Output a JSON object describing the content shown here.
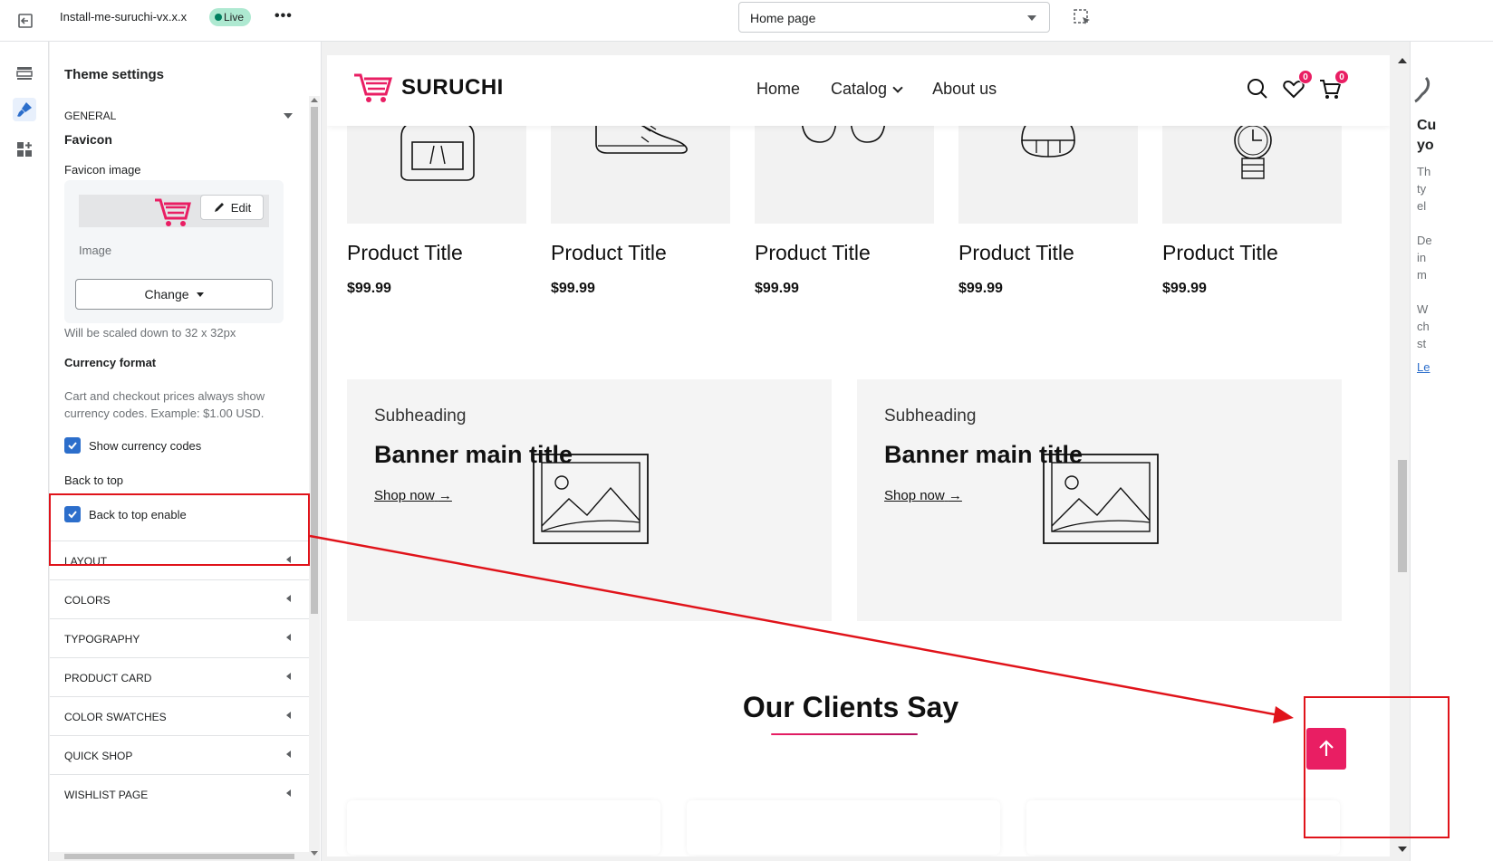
{
  "topbar": {
    "theme_name": "Install-me-suruchi-vx.x.x",
    "status": "Live",
    "more": "•••",
    "page_select": "Home page"
  },
  "sidebar": {
    "title": "Theme settings",
    "general": {
      "label": "GENERAL",
      "favicon_heading": "Favicon",
      "favicon_image_label": "Favicon image",
      "edit_label": "Edit",
      "image_label": "Image",
      "change_label": "Change",
      "scale_note": "Will be scaled down to 32 x 32px",
      "currency_heading": "Currency format",
      "currency_note": "Cart and checkout prices always show currency codes. Example: $1.00 USD.",
      "show_currency_codes": "Show currency codes",
      "back_to_top_heading": "Back to top",
      "back_to_top_enable": "Back to top enable"
    },
    "sections": [
      "LAYOUT",
      "COLORS",
      "TYPOGRAPHY",
      "PRODUCT CARD",
      "COLOR SWATCHES",
      "QUICK SHOP",
      "WISHLIST PAGE"
    ]
  },
  "preview": {
    "logo": "SURUCHI",
    "nav": [
      "Home",
      "Catalog",
      "About us"
    ],
    "wishlist_count": "0",
    "cart_count": "0",
    "products": [
      {
        "title": "Product Title",
        "price": "$99.99",
        "icon": "backpack-icon"
      },
      {
        "title": "Product Title",
        "price": "$99.99",
        "icon": "sneaker-icon"
      },
      {
        "title": "Product Title",
        "price": "$99.99",
        "icon": "glasses-icon"
      },
      {
        "title": "Product Title",
        "price": "$99.99",
        "icon": "cap-icon"
      },
      {
        "title": "Product Title",
        "price": "$99.99",
        "icon": "watch-icon"
      }
    ],
    "banners": [
      {
        "subheading": "Subheading",
        "title": "Banner main title",
        "link": "Shop now"
      },
      {
        "subheading": "Subheading",
        "title": "Banner main title",
        "link": "Shop now"
      }
    ],
    "clients_title": "Our Clients Say",
    "accent_color": "#e91e63"
  },
  "right_panel": {
    "lines": [
      "Cu",
      "yo",
      "Th",
      "ty",
      "el",
      "De",
      "in",
      "m",
      "W",
      "ch",
      "st",
      "Le"
    ]
  },
  "annotation_color": "#e0131a"
}
